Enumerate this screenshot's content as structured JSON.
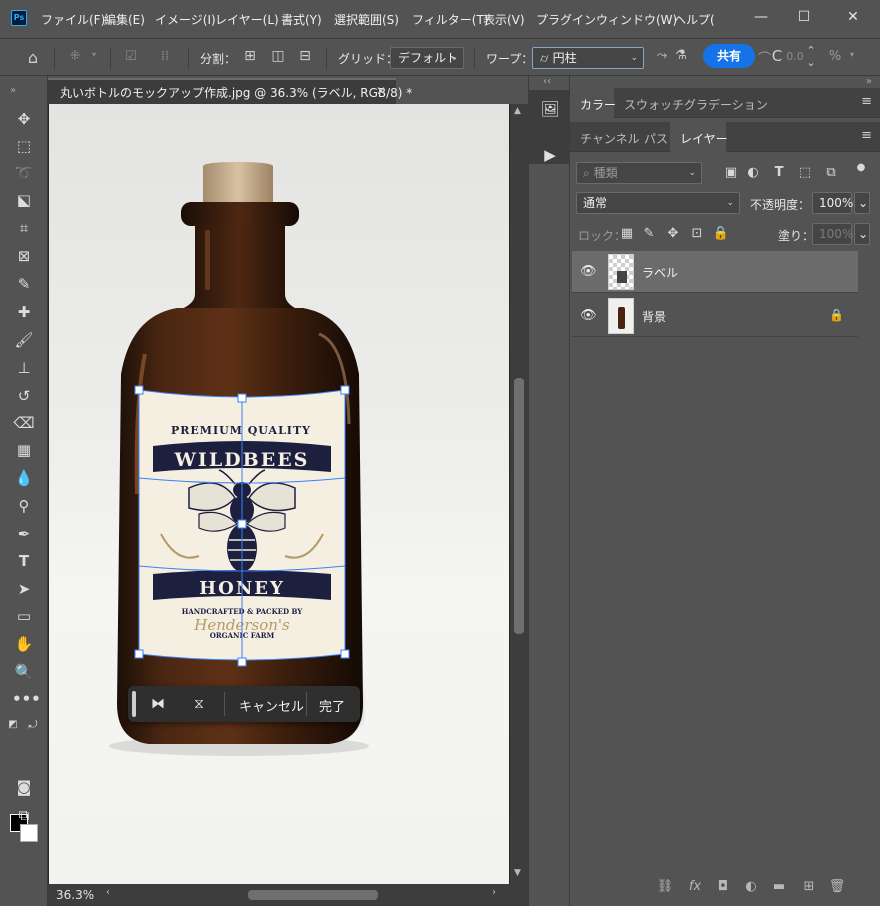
{
  "app": {
    "logo_text": "Ps"
  },
  "menubar": {
    "items": [
      "ファイル(F)",
      "編集(E)",
      "イメージ(I)",
      "レイヤー(L)",
      "書式(Y)",
      "選択範囲(S)",
      "フィルター(T)",
      "表示(V)",
      "プラグイン",
      "ウィンドウ(W)",
      "ヘルプ("
    ]
  },
  "window_controls": {
    "minimize": "—",
    "maximize": "☐",
    "close": "✕"
  },
  "options_bar": {
    "split_label": "分割：",
    "grid_label": "グリッド：",
    "grid_value": "デフォルト",
    "warp_label": "ワープ：",
    "warp_value": "円柱",
    "share_label": "共有",
    "percent_field": "0.0",
    "percent_sign": "%"
  },
  "document": {
    "tab_title": "丸いボトルのモックアップ作成.jpg @ 36.3% (ラベル, RGB/8) *",
    "zoom": "36.3%"
  },
  "label_artwork": {
    "premium": "PREMIUM QUALITY",
    "brand": "WILDBEES",
    "product": "HONEY",
    "credit": "HANDCRAFTED & PACKED BY",
    "script": "Henderson's",
    "farm": "ORGANIC FARM"
  },
  "taskbar": {
    "cancel_label": "キャンセル",
    "done_label": "完了"
  },
  "panels": {
    "top_tabs": [
      "カラー",
      "スウォッチ",
      "グラデーション"
    ],
    "layer_tabs": [
      "チャンネル",
      "パス",
      "レイヤー"
    ],
    "search_placeholder": "種類",
    "blend_mode": "通常",
    "opacity_label": "不透明度：",
    "opacity_value": "100%",
    "lock_label": "ロック：",
    "fill_label": "塗り：",
    "fill_value": "100%",
    "layers": [
      {
        "name": "ラベル",
        "selected": true,
        "locked": false
      },
      {
        "name": "背景",
        "selected": false,
        "locked": true
      }
    ]
  },
  "colors": {
    "accent": "#1473e6",
    "panel_bg": "#535353",
    "dark_bg": "#282828",
    "transform_line": "#3b82f6"
  }
}
